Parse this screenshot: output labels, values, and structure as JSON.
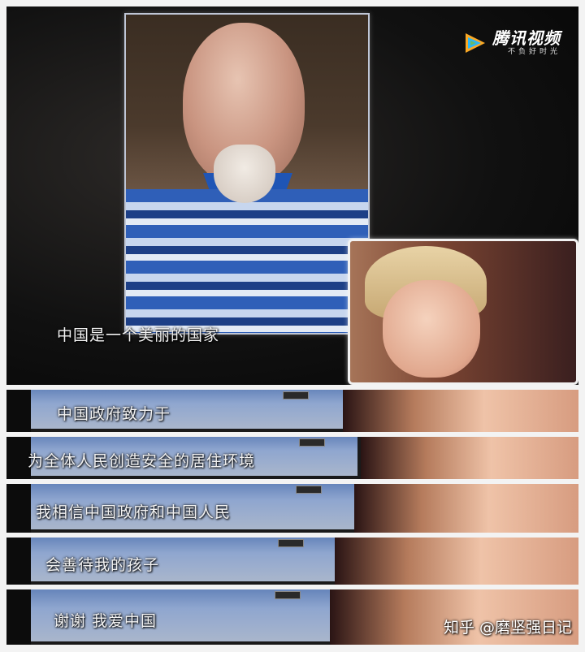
{
  "logo": {
    "name": "腾讯视频",
    "slogan": "不负好时光",
    "colors": [
      "#f9a825",
      "#29b6f6",
      "#66bb6a"
    ]
  },
  "subtitles": [
    "中国是一个美丽的国家",
    "中国政府致力于",
    "为全体人民创造安全的居住环境",
    "我相信中国政府和中国人民",
    "会善待我的孩子",
    "谢谢 我爱中国"
  ],
  "watermark": "知乎 @磨坚强日记"
}
